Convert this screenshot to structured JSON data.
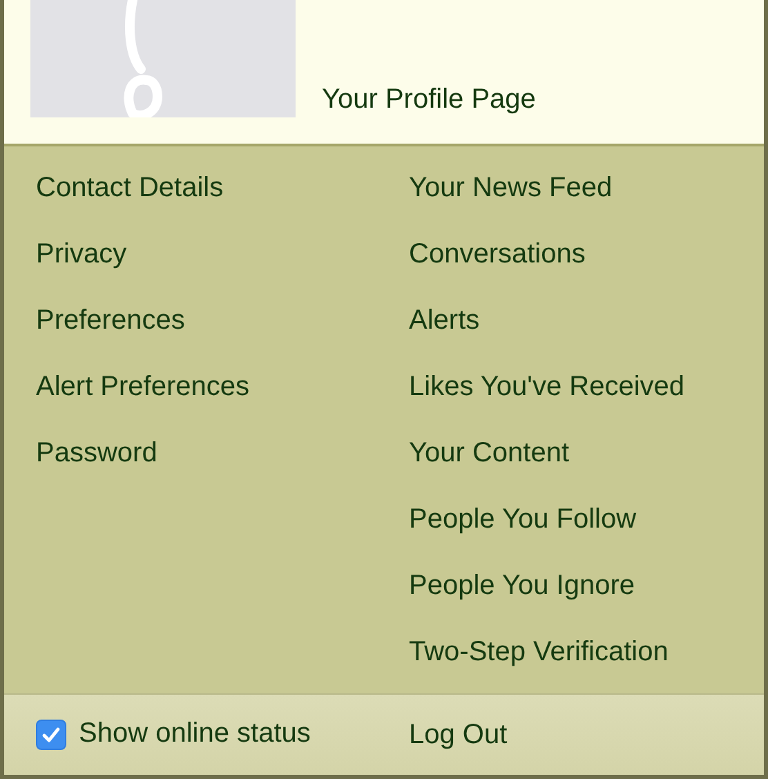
{
  "profile": {
    "title": "Your Profile Page"
  },
  "menu": {
    "left": [
      {
        "label": "Contact Details"
      },
      {
        "label": "Privacy"
      },
      {
        "label": "Preferences"
      },
      {
        "label": "Alert Preferences"
      },
      {
        "label": "Password"
      }
    ],
    "right": [
      {
        "label": "Your News Feed"
      },
      {
        "label": "Conversations"
      },
      {
        "label": "Alerts"
      },
      {
        "label": "Likes You've Received"
      },
      {
        "label": "Your Content"
      },
      {
        "label": "People You Follow"
      },
      {
        "label": "People You Ignore"
      },
      {
        "label": "Two-Step Verification"
      }
    ]
  },
  "footer": {
    "online_status": {
      "label": "Show online status",
      "checked": true
    },
    "logout": "Log Out"
  }
}
